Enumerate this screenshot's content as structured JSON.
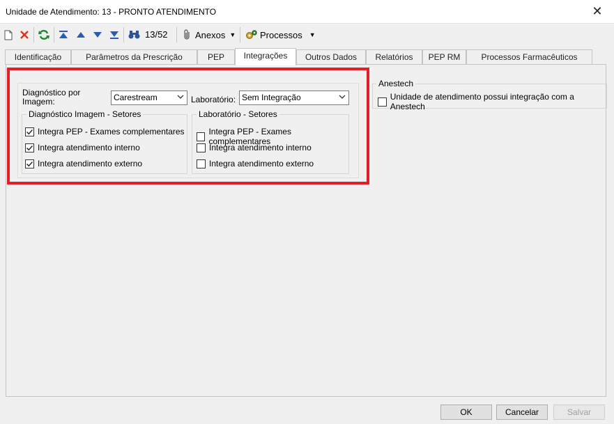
{
  "window": {
    "title": "Unidade de Atendimento: 13 - PRONTO ATENDIMENTO",
    "close_glyph": "✕"
  },
  "toolbar": {
    "icons": [
      "new-icon",
      "delete-icon",
      "refresh-icon",
      "first-record-icon",
      "previous-record-icon",
      "next-record-icon",
      "last-record-icon",
      "binoculars-icon"
    ],
    "record_counter": "13/52",
    "attachments_label": "Anexos",
    "processes_label": "Processos"
  },
  "tabs": [
    {
      "label": "Identificação",
      "active": false
    },
    {
      "label": "Parâmetros da Prescrição",
      "active": false
    },
    {
      "label": "PEP",
      "active": false
    },
    {
      "label": "Integrações",
      "active": true
    },
    {
      "label": "Outros Dados",
      "active": false
    },
    {
      "label": "Relatórios",
      "active": false
    },
    {
      "label": "PEP RM",
      "active": false
    },
    {
      "label": "Processos Farmacêuticos",
      "active": false
    }
  ],
  "integrations": {
    "diag_label_line1": "Diagnóstico por",
    "diag_label_line2": "Imagem:",
    "diag_value": "Carestream",
    "lab_label": "Laboratório:",
    "lab_value": "Sem Integração",
    "diag_sectors": {
      "title": "Diagnóstico Imagem - Setores",
      "items": [
        {
          "label": "Integra PEP - Exames complementares",
          "checked": true
        },
        {
          "label": "Integra atendimento interno",
          "checked": true
        },
        {
          "label": "Integra atendimento externo",
          "checked": true
        }
      ]
    },
    "lab_sectors": {
      "title": "Laboratório - Setores",
      "items": [
        {
          "label": "Integra PEP - Exames complementares",
          "checked": false
        },
        {
          "label": "Integra atendimento interno",
          "checked": false
        },
        {
          "label": "Integra atendimento externo",
          "checked": false
        }
      ]
    }
  },
  "anestech": {
    "title": "Anestech",
    "option": {
      "label": "Unidade de atendimento possui integração com a Anestech",
      "checked": false
    }
  },
  "footer": {
    "ok": "OK",
    "cancel": "Cancelar",
    "save": "Salvar"
  },
  "colors": {
    "highlight": "#e41e25",
    "window_bg": "#f0f0f0"
  }
}
